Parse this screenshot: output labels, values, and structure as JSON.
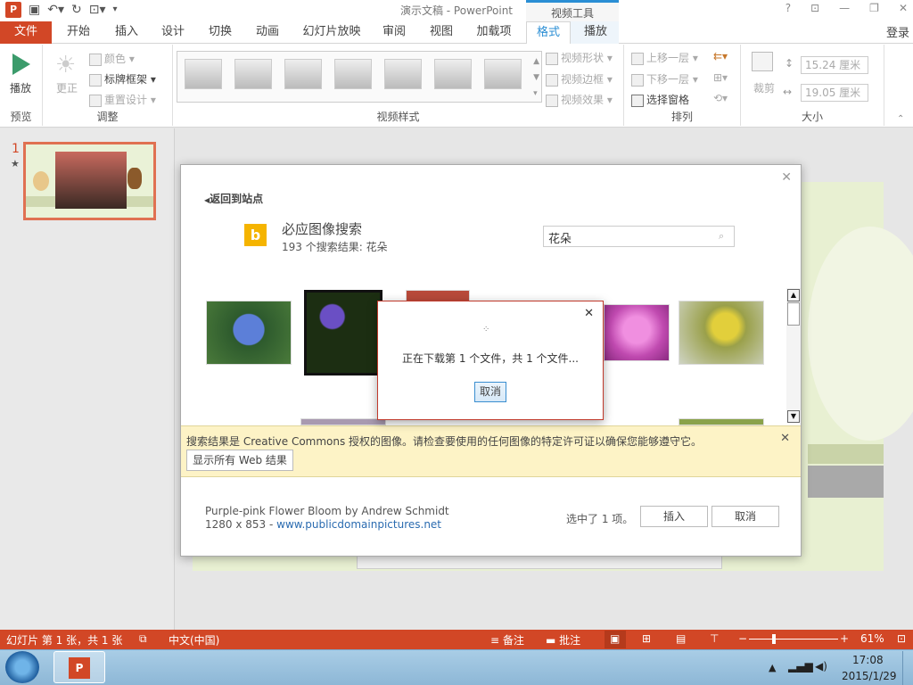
{
  "window": {
    "title": "演示文稿 - PowerPoint",
    "context_tab_header": "视频工具",
    "help": "?",
    "login": "登录"
  },
  "tabs": [
    "文件",
    "开始",
    "插入",
    "设计",
    "切换",
    "动画",
    "幻灯片放映",
    "审阅",
    "视图",
    "加载项",
    "格式",
    "播放"
  ],
  "ribbon": {
    "preview": {
      "play": "播放",
      "label": "预览"
    },
    "adjust": {
      "correct": "更正",
      "color": "颜色",
      "poster": "标牌框架",
      "reset": "重置设计",
      "label": "调整"
    },
    "styles": {
      "label": "视频样式",
      "shape": "视频形状",
      "border": "视频边框",
      "effects": "视频效果"
    },
    "arrange": {
      "forward": "上移一层",
      "backward": "下移一层",
      "pane": "选择窗格",
      "label": "排列"
    },
    "size": {
      "crop": "裁剪",
      "height": "15.24 厘米",
      "width": "19.05 厘米",
      "label": "大小"
    }
  },
  "slides_pane": {
    "number": "1",
    "star": "★"
  },
  "dialog": {
    "back": "返回到站点",
    "heading": "必应图像搜索",
    "results": "193 个搜索结果: 花朵",
    "query": "花朵",
    "notice": "搜索结果是 Creative Commons 授权的图像。请检查要使用的任何图像的特定许可证以确保您能够遵守它。",
    "show_all": "显示所有 Web 结果",
    "info_title": "Purple-pink Flower Bloom by Andrew Schmidt",
    "info_size": "1280 x 853 - ",
    "info_link": "www.publicdomainpictures.net",
    "selected": "选中了 1 项。",
    "insert": "插入",
    "cancel": "取消"
  },
  "download": {
    "message": "正在下载第 1 个文件，共 1 个文件...",
    "cancel": "取消"
  },
  "status": {
    "slide": "幻灯片 第 1 张，共 1 张",
    "lang": "中文(中国)",
    "notes": "备注",
    "comments": "批注",
    "zoom": "61%"
  },
  "taskbar": {
    "time": "17:08",
    "date": "2015/1/29"
  },
  "colors": {
    "accent": "#d24726",
    "link": "#2a6bb0",
    "notice": "#fdf3c6"
  }
}
